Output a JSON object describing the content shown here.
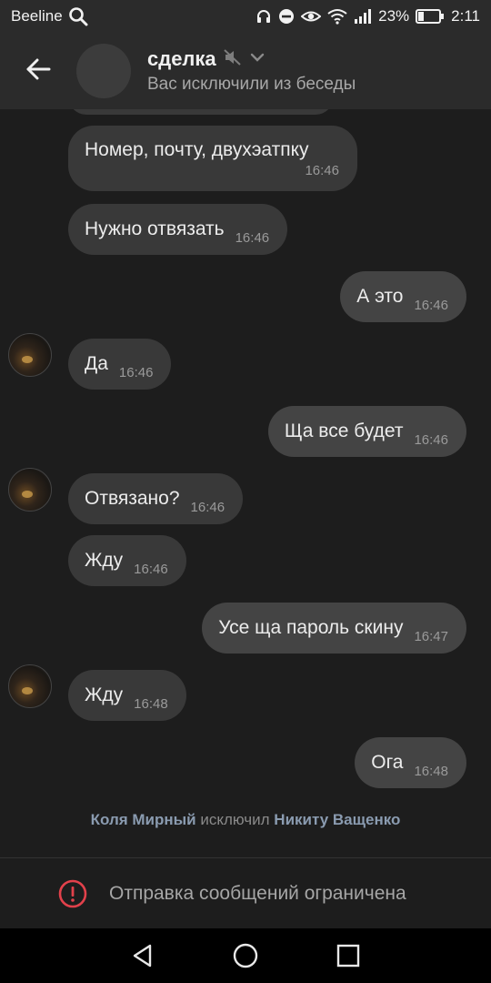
{
  "status_bar": {
    "carrier": "Beeline",
    "battery_percent": "23%",
    "time": "2:11",
    "icons": [
      "search-icon",
      "headphones-icon",
      "dnd-icon",
      "eye-icon",
      "wifi-icon",
      "signal-icon",
      "battery-icon"
    ]
  },
  "header": {
    "title": "сделка",
    "subtitle": "Вас исключили из беседы",
    "icons": [
      "back-arrow-icon",
      "muted-icon",
      "chevron-down-icon"
    ]
  },
  "messages": [
    {
      "text": "Номер, почту, двухэатпку",
      "time": "16:46",
      "direction": "in"
    },
    {
      "text": "Нужно отвязать",
      "time": "16:46",
      "direction": "in"
    },
    {
      "text": "А это",
      "time": "16:46",
      "direction": "out"
    },
    {
      "text": "Да",
      "time": "16:46",
      "direction": "in"
    },
    {
      "text": "Ща все будет",
      "time": "16:46",
      "direction": "out"
    },
    {
      "text": "Отвязано?",
      "time": "16:46",
      "direction": "in"
    },
    {
      "text": "Жду",
      "time": "16:46",
      "direction": "in"
    },
    {
      "text": "Усе ща пароль скину",
      "time": "16:47",
      "direction": "out"
    },
    {
      "text": "Жду",
      "time": "16:48",
      "direction": "in"
    },
    {
      "text": "Ога",
      "time": "16:48",
      "direction": "out"
    }
  ],
  "service_message": {
    "actor": "Коля Мирный",
    "action": "исключил",
    "target": "Никиту Ващенко"
  },
  "restriction": {
    "text": "Отправка сообщений ограничена",
    "icon": "alert-circle-icon",
    "icon_color": "#e2414b"
  },
  "nav_bar": {
    "icons": [
      "nav-back-icon",
      "nav-home-icon",
      "nav-recents-icon"
    ]
  }
}
